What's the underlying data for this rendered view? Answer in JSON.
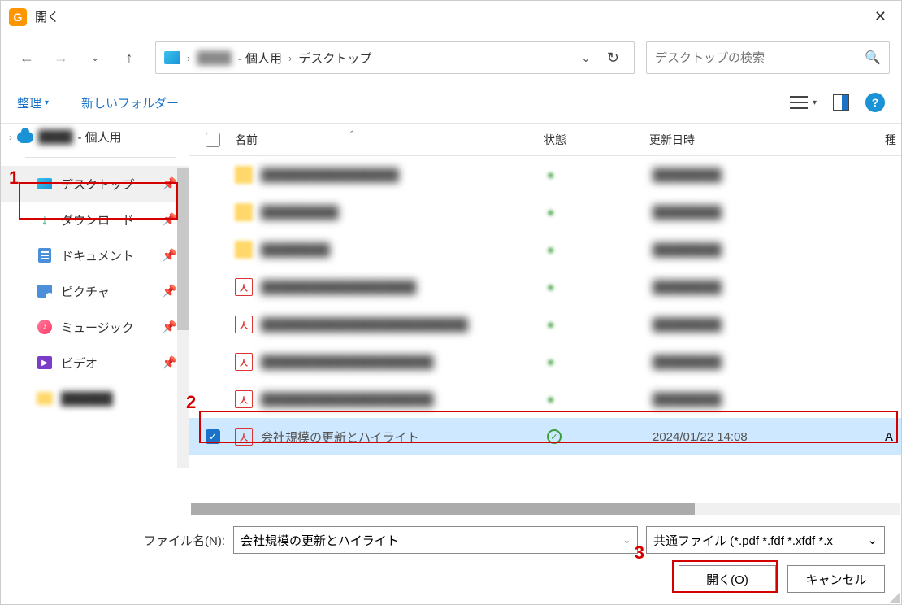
{
  "titlebar": {
    "title": "開く",
    "app_glyph": "G"
  },
  "nav": {
    "path_user_blur": "████",
    "path_personal": " - 個人用",
    "path_desktop": "デスクトップ",
    "search_placeholder": "デスクトップの検索"
  },
  "toolbar": {
    "organize": "整理",
    "new_folder": "新しいフォルダー"
  },
  "sidebar": {
    "root_blur": "████",
    "root_personal": " - 個人用",
    "items": [
      {
        "label": "デスクトップ",
        "icon": "desktop",
        "pinned": true,
        "selected": true
      },
      {
        "label": "ダウンロード",
        "icon": "download",
        "pinned": true
      },
      {
        "label": "ドキュメント",
        "icon": "doc",
        "pinned": true
      },
      {
        "label": "ピクチャ",
        "icon": "pic",
        "pinned": true
      },
      {
        "label": "ミュージック",
        "icon": "music",
        "pinned": true
      },
      {
        "label": "ビデオ",
        "icon": "video",
        "pinned": true
      },
      {
        "label": "██████",
        "icon": "folder",
        "pinned": false,
        "blur": true
      }
    ]
  },
  "columns": {
    "name": "名前",
    "status": "状態",
    "date": "更新日時",
    "type": "種"
  },
  "files": [
    {
      "icon": "folder",
      "name": "████████████████",
      "status": "●",
      "date": "████████",
      "type": ""
    },
    {
      "icon": "folder",
      "name": "█████████",
      "status": "●",
      "date": "████████",
      "type": ""
    },
    {
      "icon": "folder",
      "name": "████████",
      "status": "●",
      "date": "████████",
      "type": ""
    },
    {
      "icon": "pdf",
      "name": "██████████████████",
      "status": "●",
      "date": "████████",
      "type": ""
    },
    {
      "icon": "pdf",
      "name": "████████████████████████",
      "status": "●",
      "date": "████████",
      "type": ""
    },
    {
      "icon": "pdf",
      "name": "████████████████████",
      "status": "●",
      "date": "████████",
      "type": ""
    },
    {
      "icon": "pdf",
      "name": "████████████████████",
      "status": "●",
      "date": "████████",
      "type": ""
    }
  ],
  "selected_file": {
    "name": "会社規模の更新とハイライト",
    "date": "2024/01/22 14:08",
    "type": "A"
  },
  "footer": {
    "filename_label": "ファイル名(N):",
    "filename_value": "会社規模の更新とハイライト",
    "filter": "共通ファイル (*.pdf *.fdf *.xfdf *.x",
    "open": "開く(O)",
    "cancel": "キャンセル"
  },
  "annotations": {
    "n1": "1",
    "n2": "2",
    "n3": "3"
  }
}
